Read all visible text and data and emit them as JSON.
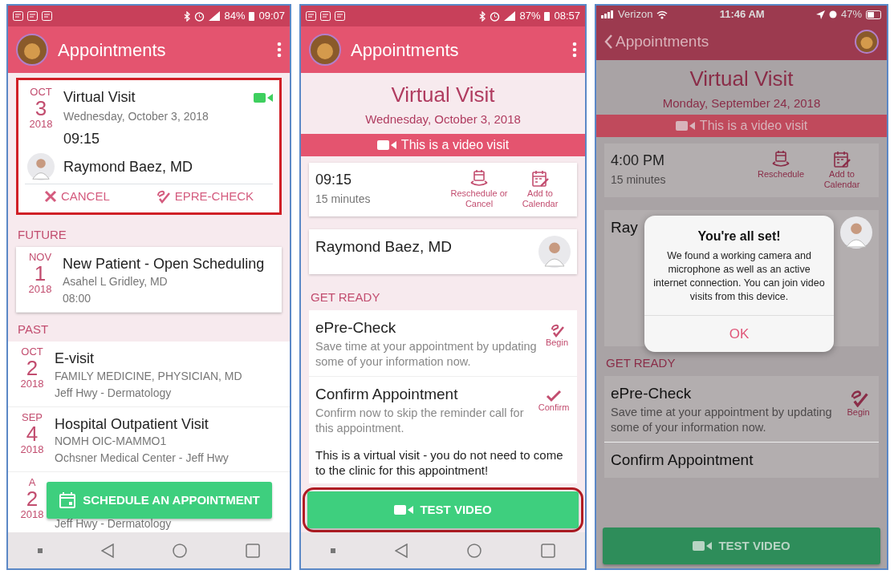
{
  "panels": [
    {
      "kind": "list",
      "status_bar": {
        "kind": "android",
        "battery": "84%",
        "time": "09:07"
      },
      "app_bar": {
        "kind": "title",
        "title": "Appointments"
      },
      "current": {
        "month": "OCT",
        "day": "3",
        "year": "2018",
        "title": "Virtual Visit",
        "date": "Wednesday, October 3, 2018",
        "time": "09:15",
        "provider": "Raymond Baez, MD",
        "video": true,
        "highlighted": true,
        "actions": [
          {
            "kind": "cancel",
            "label": "CANCEL"
          },
          {
            "kind": "precheck",
            "label": "EPRE-CHECK"
          }
        ]
      },
      "sections": [
        {
          "heading": "FUTURE",
          "boxed": true,
          "items": [
            {
              "month": "NOV",
              "day": "1",
              "year": "2018",
              "title": "New Patient - Open Scheduling",
              "lines": [
                "Asahel L Gridley, MD",
                "08:00"
              ]
            }
          ]
        },
        {
          "heading": "PAST",
          "boxed": false,
          "items": [
            {
              "month": "OCT",
              "day": "2",
              "year": "2018",
              "title": "E-visit",
              "lines": [
                "FAMILY MEDICINE, PHYSICIAN, MD",
                "Jeff Hwy - Dermatology"
              ]
            },
            {
              "month": "SEP",
              "day": "4",
              "year": "2018",
              "title": "Hospital Outpatient Visit",
              "lines": [
                "NOMH OIC-MAMMO1",
                "Ochsner Medical Center - Jeff Hwy"
              ]
            },
            {
              "month": "A",
              "day": "2",
              "year": "2018",
              "lines": [
                "Jeff Hwy - Dermatology"
              ]
            }
          ]
        }
      ],
      "button": {
        "label": "SCHEDULE AN APPOINTMENT"
      }
    },
    {
      "kind": "detail",
      "status_bar": {
        "kind": "android",
        "battery": "87%",
        "time": "08:57"
      },
      "app_bar": {
        "kind": "title",
        "title": "Appointments"
      },
      "header": {
        "title": "Virtual Visit",
        "date": "Wednesday, October 3, 2018"
      },
      "banner": "This is a video visit",
      "time_card": {
        "time": "09:15",
        "duration": "15 minutes",
        "actions": [
          {
            "kind": "reschedule",
            "label": "Reschedule or Cancel"
          },
          {
            "kind": "calendar",
            "label": "Add to Calendar"
          }
        ]
      },
      "provider": "Raymond Baez, MD",
      "section": "GET READY",
      "tasks": [
        {
          "kind": "precheck",
          "title": "ePre-Check",
          "text": "Save time at your appointment by updating some of your information now.",
          "action": "Begin"
        },
        {
          "kind": "confirm",
          "title": "Confirm Appointment",
          "text": "Confirm now to skip the reminder call for this appointment.",
          "action": "Confirm"
        }
      ],
      "note": "This is a virtual visit - you do not need to come to the clinic for this appointment!",
      "button": {
        "label": "TEST VIDEO",
        "highlighted": true
      },
      "dimmed": false
    },
    {
      "kind": "detail",
      "status_bar": {
        "kind": "ios",
        "carrier": "Verizon",
        "time": "11:46 AM",
        "battery": "47%"
      },
      "app_bar": {
        "kind": "back",
        "title": "Appointments"
      },
      "header": {
        "title": "Virtual Visit",
        "date": "Monday, September 24, 2018"
      },
      "banner": "This is a video visit",
      "time_card": {
        "time": "4:00 PM",
        "duration": "15 minutes",
        "actions": [
          {
            "kind": "reschedule",
            "label": "Reschedule"
          },
          {
            "kind": "calendar",
            "label": "Add to Calendar"
          }
        ]
      },
      "provider": "Ray",
      "section": "GET READY",
      "tasks": [
        {
          "kind": "precheck",
          "title": "ePre-Check",
          "text": "Save time at your appointment by updating some of your information now.",
          "action": "Begin"
        },
        {
          "kind": "confirm",
          "title": "Confirm Appointment"
        }
      ],
      "button": {
        "label": "TEST VIDEO",
        "highlighted": false
      },
      "dimmed": true,
      "dialog": {
        "title": "You're all set!",
        "message": "We found a working camera and microphone as well as an active internet connection. You can join video visits from this device.",
        "button": "OK"
      }
    }
  ]
}
